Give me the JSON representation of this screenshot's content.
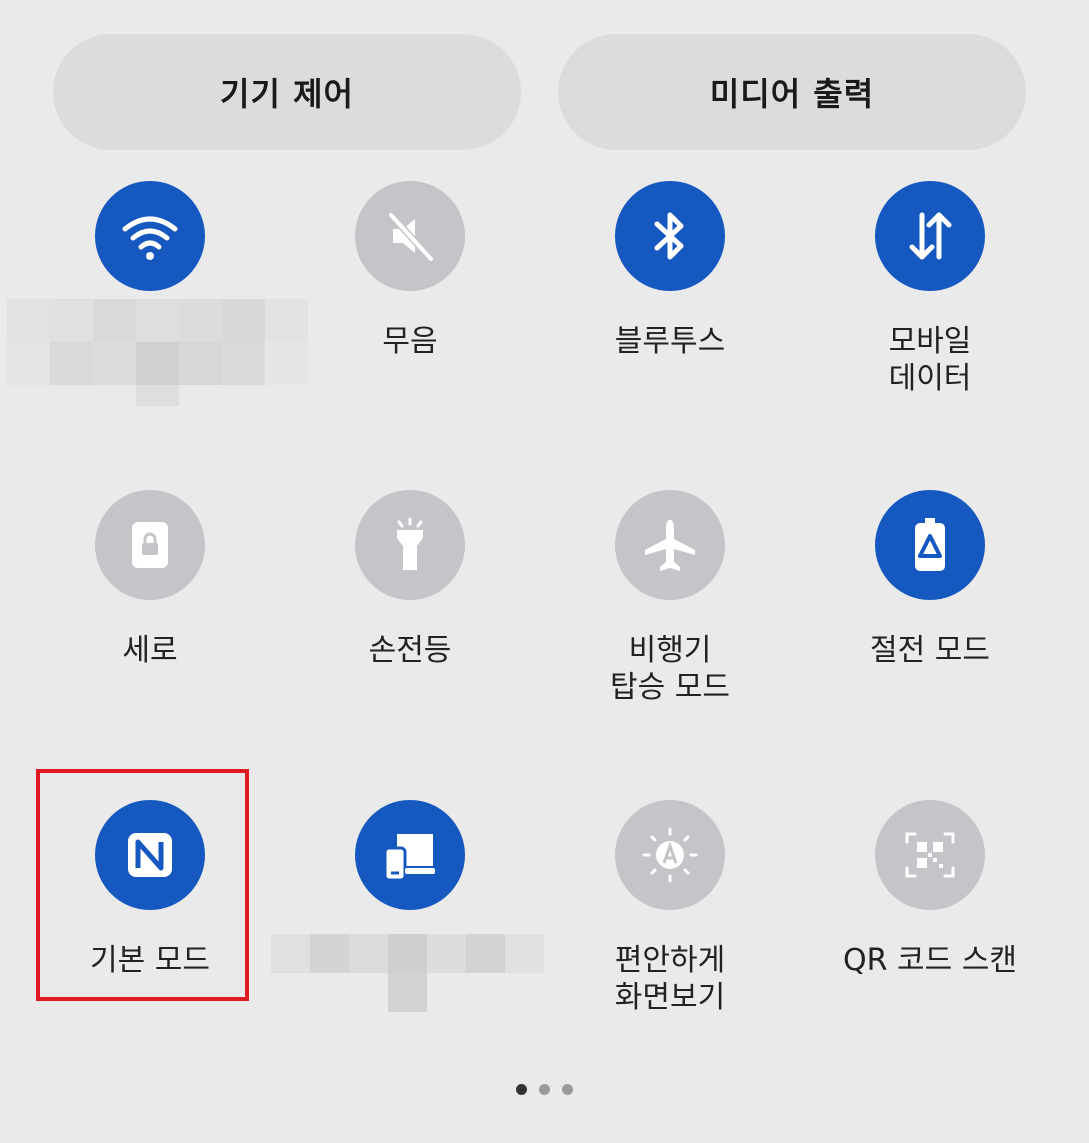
{
  "top_buttons": {
    "device_control": "기기 제어",
    "media_output": "미디어 출력"
  },
  "tiles": [
    {
      "id": "wifi",
      "label": "",
      "state": "on",
      "icon": "wifi-icon"
    },
    {
      "id": "mute",
      "label": "무음",
      "state": "off",
      "icon": "mute-icon"
    },
    {
      "id": "bluetooth",
      "label": "블루투스",
      "state": "on",
      "icon": "bluetooth-icon"
    },
    {
      "id": "mobile-data",
      "label": "모바일\n데이터",
      "state": "on",
      "icon": "mobile-data-icon"
    },
    {
      "id": "portrait",
      "label": "세로",
      "state": "off",
      "icon": "rotation-lock-icon"
    },
    {
      "id": "flashlight",
      "label": "손전등",
      "state": "off",
      "icon": "flashlight-icon"
    },
    {
      "id": "airplane",
      "label": "비행기\n탑승 모드",
      "state": "off",
      "icon": "airplane-icon"
    },
    {
      "id": "power-saving",
      "label": "절전 모드",
      "state": "on",
      "icon": "battery-saver-icon"
    },
    {
      "id": "nfc",
      "label": "기본 모드",
      "state": "on",
      "icon": "nfc-icon"
    },
    {
      "id": "link-to-windows",
      "label": "",
      "state": "on",
      "icon": "devices-icon"
    },
    {
      "id": "eye-comfort",
      "label": "편안하게\n화면보기",
      "state": "off",
      "icon": "eye-comfort-icon"
    },
    {
      "id": "qr-scan",
      "label": "QR 코드 스캔",
      "state": "off",
      "icon": "qr-scan-icon"
    }
  ],
  "pagination": {
    "pages": 3,
    "current": 1
  },
  "colors": {
    "active": "#1558bf",
    "inactive": "#c4c5c9",
    "highlight": "#e01a22"
  }
}
